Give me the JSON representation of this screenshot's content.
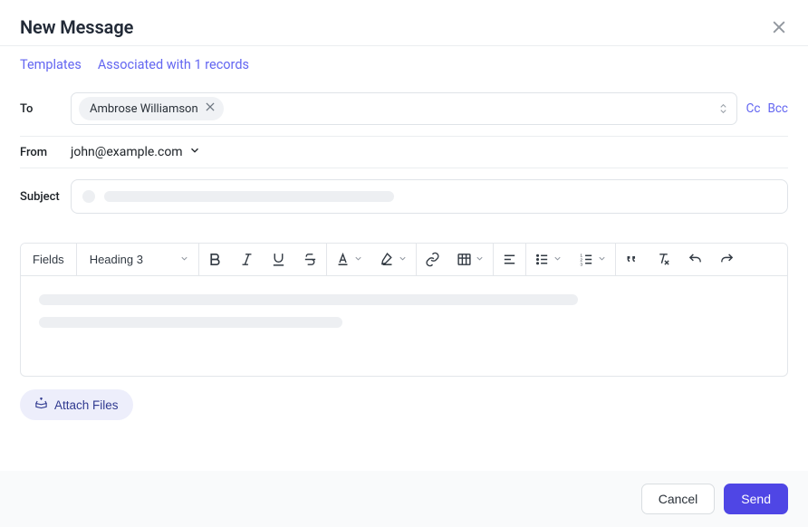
{
  "header": {
    "title": "New Message"
  },
  "links": {
    "templates": "Templates",
    "associated": "Associated with 1 records"
  },
  "to": {
    "label": "To",
    "chip": "Ambrose Williamson",
    "cc": "Cc",
    "bcc": "Bcc"
  },
  "from": {
    "label": "From",
    "value": "john@example.com"
  },
  "subject": {
    "label": "Subject"
  },
  "toolbar": {
    "fields": "Fields",
    "heading": "Heading 3"
  },
  "attach": {
    "label": "Attach Files"
  },
  "footer": {
    "cancel": "Cancel",
    "send": "Send"
  },
  "colors": {
    "primary": "#6366f1",
    "send": "#4f46e5"
  }
}
